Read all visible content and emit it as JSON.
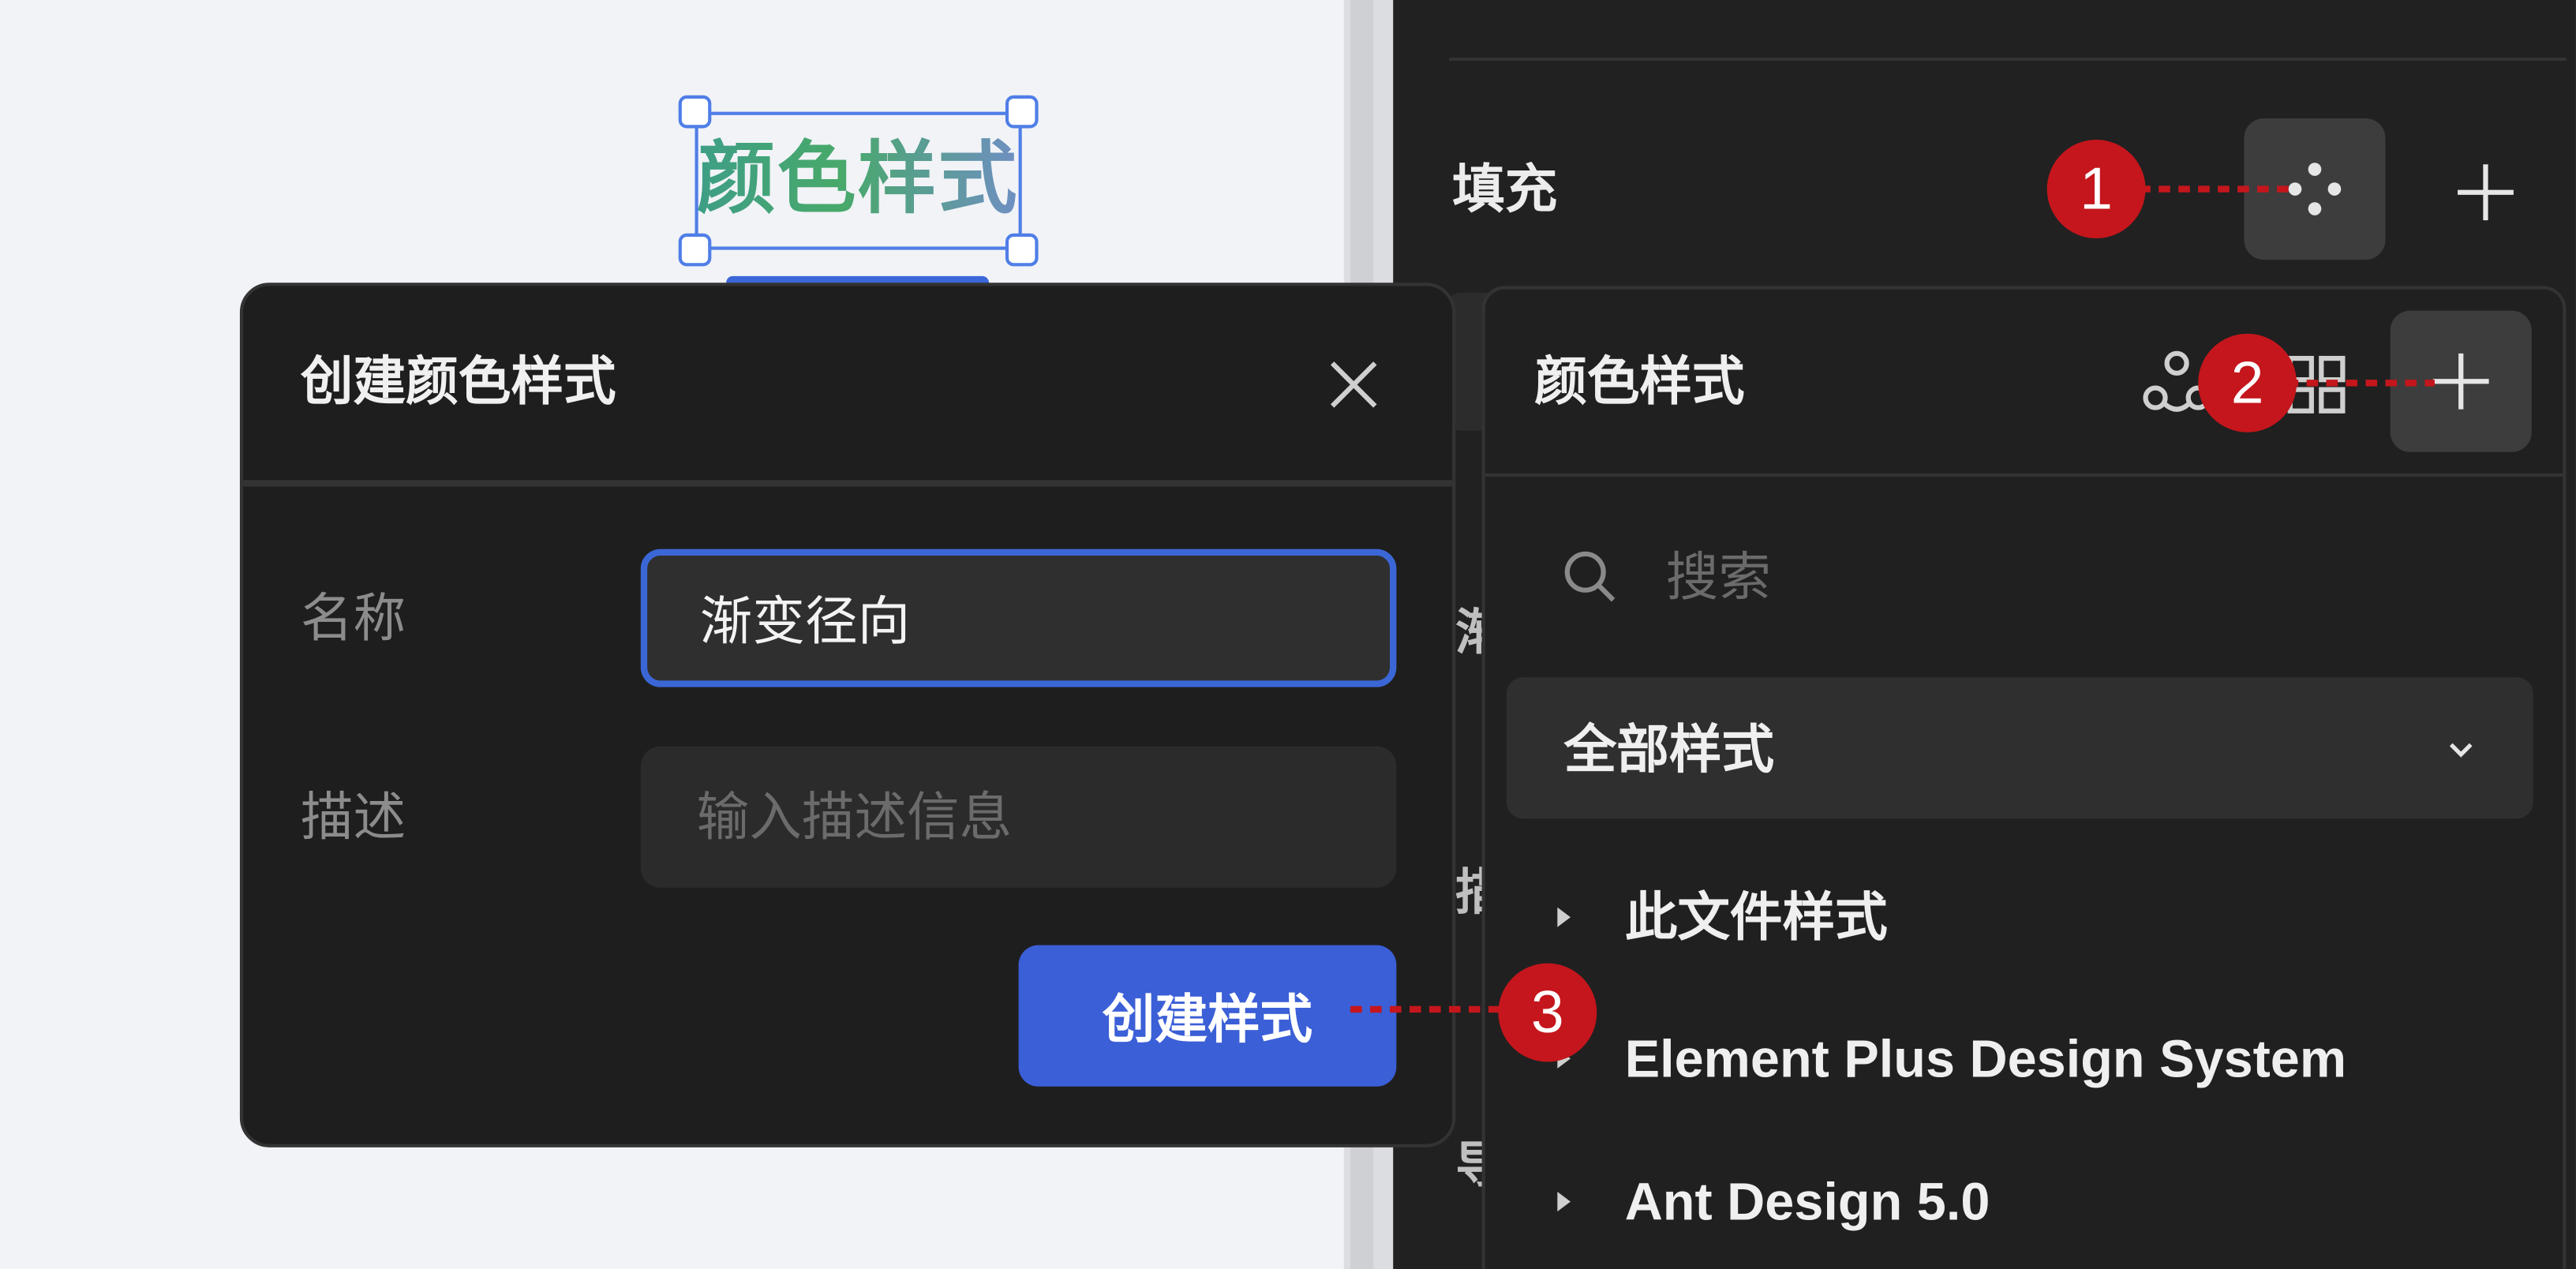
{
  "canvas": {
    "selected_text": "颜色样式"
  },
  "fill_panel": {
    "label": "填充",
    "peek_labels": [
      "渐",
      "描",
      "导"
    ]
  },
  "color_styles_panel": {
    "title": "颜色样式",
    "search_placeholder": "搜索",
    "filter_label": "全部样式",
    "libraries": [
      {
        "label": "此文件样式"
      },
      {
        "label": "Element Plus Design System"
      },
      {
        "label": "Ant Design 5.0"
      }
    ]
  },
  "dialog": {
    "title": "创建颜色样式",
    "name_label": "名称",
    "name_value": "渐变径向",
    "desc_label": "描述",
    "desc_placeholder": "输入描述信息",
    "submit_label": "创建样式"
  },
  "callouts": [
    "1",
    "2",
    "3"
  ],
  "colors": {
    "accent": "#3b5fd6",
    "callout": "#c4161c",
    "panel_bg": "#212121",
    "canvas_bg": "#f1f3f7"
  }
}
